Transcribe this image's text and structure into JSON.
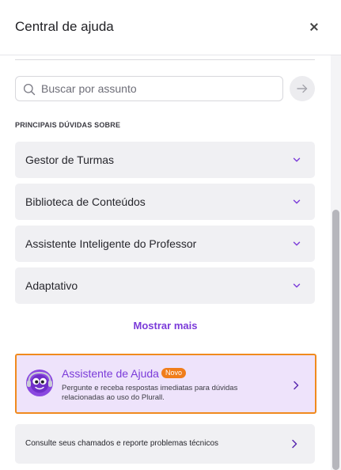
{
  "header": {
    "title": "Central de ajuda",
    "close_icon": "close-icon"
  },
  "search": {
    "placeholder": "Buscar por assunto",
    "value": "",
    "icon": "search-icon",
    "submit_icon": "arrow-right-icon"
  },
  "faq": {
    "section_label": "PRINCIPAIS DÚVIDAS SOBRE",
    "items": [
      {
        "label": "Gestor de Turmas"
      },
      {
        "label": "Biblioteca de Conteúdos"
      },
      {
        "label": "Assistente Inteligente do Professor"
      },
      {
        "label": "Adaptativo"
      }
    ],
    "show_more": "Mostrar mais"
  },
  "assistant": {
    "title": "Assistente de Ajuda",
    "badge": "Novo",
    "description": "Pergunte e receba respostas imediatas para dúvidas relacionadas ao uso do Plurall."
  },
  "tickets": {
    "label": "Consulte seus chamados e reporte problemas técnicos"
  },
  "colors": {
    "accent": "#7b3bd9",
    "badge": "#f07d1a",
    "highlight_border": "#f08a1e",
    "card_bg": "#f0f0f3",
    "assistant_bg": "#eee3fb"
  }
}
